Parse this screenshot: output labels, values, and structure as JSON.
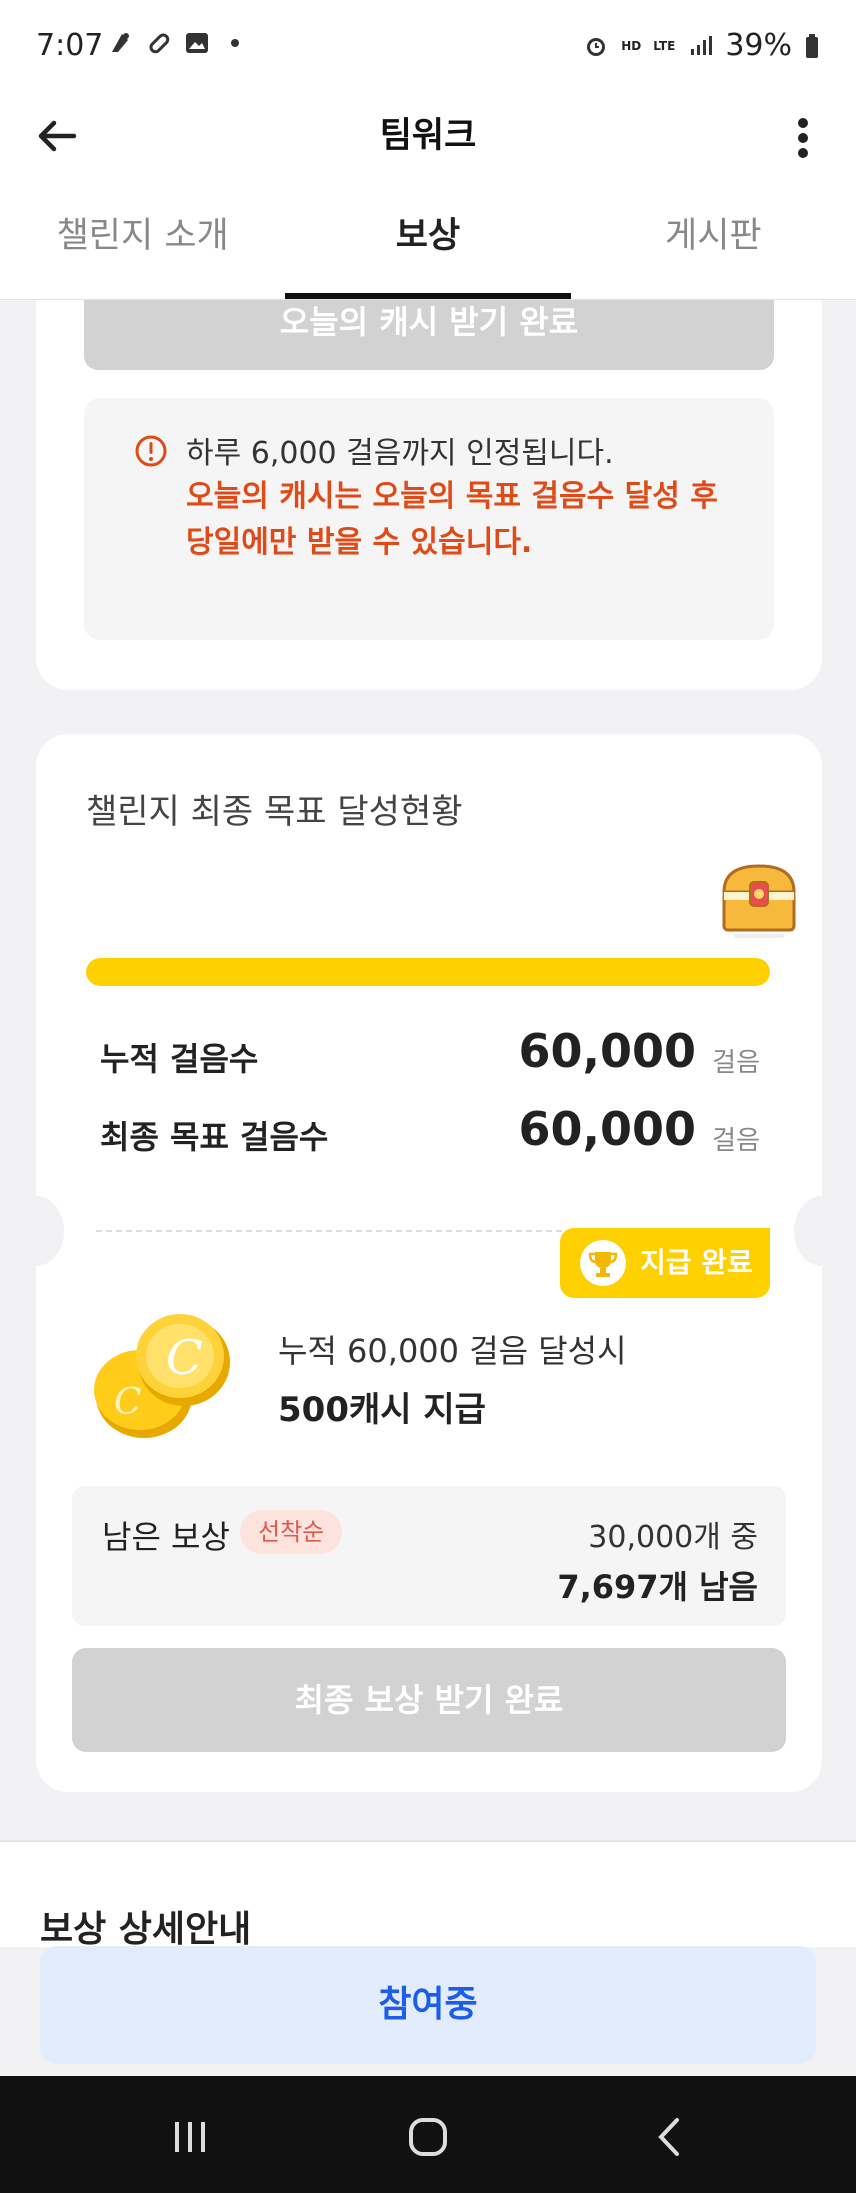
{
  "status": {
    "time": "7:07",
    "battery": "39%",
    "net_hd": "HD",
    "net_lte": "LTE"
  },
  "header": {
    "title": "팀워크"
  },
  "tabs": [
    {
      "label": "챌린지 소개"
    },
    {
      "label": "보상"
    },
    {
      "label": "게시판"
    }
  ],
  "today": {
    "button_label": "오늘의 캐시 받기 완료",
    "notice_line1": "하루 6,000 걸음까지 인정됩니다.",
    "notice_red_1": "오늘의 캐시는 오늘의 목표 걸음수 달성 후",
    "notice_red_2": "당일에만 받을 수 있습니다."
  },
  "goal": {
    "title": "챌린지 최종 목표 달성현황",
    "progress": 1.0,
    "accumulated_label": "누적 걸음수",
    "accumulated_value": "60,000",
    "target_label": "최종 목표 걸음수",
    "target_value": "60,000",
    "unit": "걸음",
    "badge": "지급 완료",
    "reward_desc": "누적 60,000 걸음 달성시",
    "reward_amount": "500캐시 지급",
    "remaining_label": "남은 보상",
    "remaining_tag": "선착순",
    "remaining_total": "30,000개 중",
    "remaining_left": "7,697개 남음",
    "final_button": "최종 보상 받기 완료"
  },
  "detail": {
    "title": "보상 상세안내"
  },
  "cta": {
    "label": "참여중"
  },
  "colors": {
    "accent_yellow": "#ffd000",
    "warning_red": "#e04a16",
    "cta_blue": "#1d5ee8",
    "cta_bg": "#e3ecfd"
  }
}
